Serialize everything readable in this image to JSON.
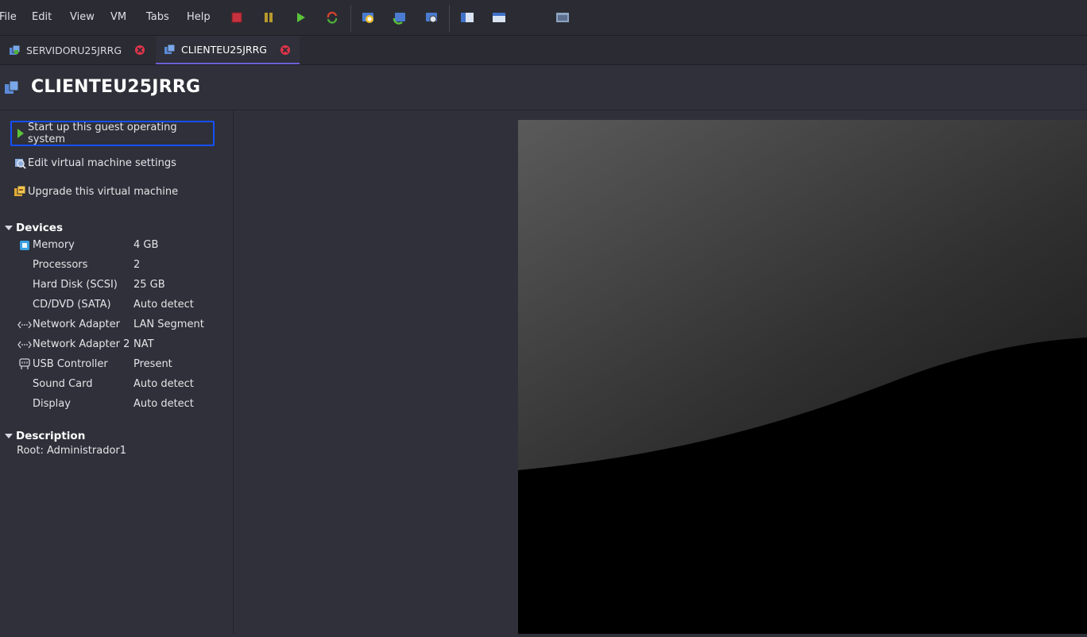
{
  "menu": [
    "File",
    "Edit",
    "View",
    "VM",
    "Tabs",
    "Help"
  ],
  "toolbar": {
    "icons": [
      "power-off-icon",
      "suspend-icon",
      "power-on-icon",
      "reset-icon",
      "snapshot-icon",
      "revert-snapshot-icon",
      "snapshot-manager-icon",
      "console-view-icon",
      "fullscreen-icon",
      "unity-icon"
    ]
  },
  "tabs": [
    {
      "label": "SERVIDORU25JRRG",
      "active": false
    },
    {
      "label": "CLIENTEU25JRRG",
      "active": true
    }
  ],
  "vm": {
    "title": "CLIENTEU25JRRG"
  },
  "actions": {
    "start": "Start up this guest operating system",
    "edit": "Edit virtual machine settings",
    "upgrade": "Upgrade this virtual machine"
  },
  "devices": {
    "title": "Devices",
    "rows": [
      {
        "name": "Memory",
        "value": "4 GB",
        "icon": "memory-icon"
      },
      {
        "name": "Processors",
        "value": "2",
        "icon": "processor-icon"
      },
      {
        "name": "Hard Disk (SCSI)",
        "value": "25 GB",
        "icon": "hard-disk-icon"
      },
      {
        "name": "CD/DVD (SATA)",
        "value": "Auto detect",
        "icon": "cd-dvd-icon"
      },
      {
        "name": "Network Adapter",
        "value": "LAN Segment",
        "icon": "network-adapter-icon"
      },
      {
        "name": "Network Adapter 2",
        "value": "NAT",
        "icon": "network-adapter-icon"
      },
      {
        "name": "USB Controller",
        "value": "Present",
        "icon": "usb-icon"
      },
      {
        "name": "Sound Card",
        "value": "Auto detect",
        "icon": "sound-card-icon"
      },
      {
        "name": "Display",
        "value": "Auto detect",
        "icon": "display-icon"
      }
    ]
  },
  "description": {
    "title": "Description",
    "text": "Root: Administrador1"
  },
  "colors": {
    "background": "#2f3039",
    "toolbar": "#2b2c33",
    "selection_border": "#1450ff",
    "active_tab_underline": "#6b5fd6",
    "close_red": "#e0344a",
    "play_green": "#5bc43a"
  }
}
